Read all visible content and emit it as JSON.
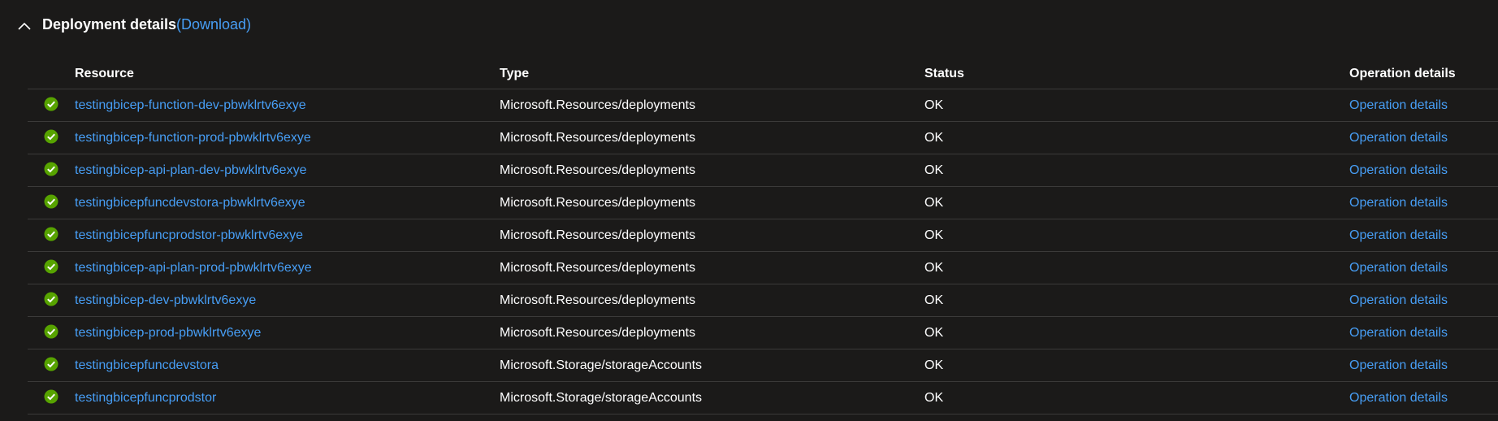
{
  "section": {
    "title": "Deployment details",
    "download_label": "(Download)"
  },
  "table": {
    "columns": [
      "Resource",
      "Type",
      "Status",
      "Operation details"
    ],
    "rows": [
      {
        "resource": "testingbicep-function-dev-pbwklrtv6exye",
        "type": "Microsoft.Resources/deployments",
        "status": "OK",
        "operation": "Operation details"
      },
      {
        "resource": "testingbicep-function-prod-pbwklrtv6exye",
        "type": "Microsoft.Resources/deployments",
        "status": "OK",
        "operation": "Operation details"
      },
      {
        "resource": "testingbicep-api-plan-dev-pbwklrtv6exye",
        "type": "Microsoft.Resources/deployments",
        "status": "OK",
        "operation": "Operation details"
      },
      {
        "resource": "testingbicepfuncdevstora-pbwklrtv6exye",
        "type": "Microsoft.Resources/deployments",
        "status": "OK",
        "operation": "Operation details"
      },
      {
        "resource": "testingbicepfuncprodstor-pbwklrtv6exye",
        "type": "Microsoft.Resources/deployments",
        "status": "OK",
        "operation": "Operation details"
      },
      {
        "resource": "testingbicep-api-plan-prod-pbwklrtv6exye",
        "type": "Microsoft.Resources/deployments",
        "status": "OK",
        "operation": "Operation details"
      },
      {
        "resource": "testingbicep-dev-pbwklrtv6exye",
        "type": "Microsoft.Resources/deployments",
        "status": "OK",
        "operation": "Operation details"
      },
      {
        "resource": "testingbicep-prod-pbwklrtv6exye",
        "type": "Microsoft.Resources/deployments",
        "status": "OK",
        "operation": "Operation details"
      },
      {
        "resource": "testingbicepfuncdevstora",
        "type": "Microsoft.Storage/storageAccounts",
        "status": "OK",
        "operation": "Operation details"
      },
      {
        "resource": "testingbicepfuncprodstor",
        "type": "Microsoft.Storage/storageAccounts",
        "status": "OK",
        "operation": "Operation details"
      }
    ]
  },
  "icons": {
    "collapse": "chevron-up-icon",
    "success": "success-check-icon"
  },
  "colors": {
    "background": "#1b1a19",
    "link": "#479ef5",
    "success": "#57a300",
    "divider": "#3b3a39"
  }
}
